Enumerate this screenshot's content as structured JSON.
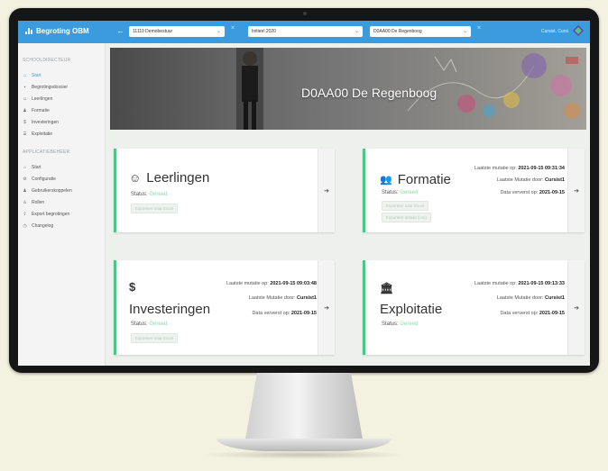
{
  "app": {
    "brand": "Begroting OBM",
    "back_label": "←",
    "selectors": [
      {
        "value": "11110 Demobestuur",
        "clear": "×"
      },
      {
        "value": "Initieel 2020",
        "clear": ""
      },
      {
        "value": "D0AA00 De Regenboog",
        "clear": "×"
      }
    ],
    "user": "Cursist, Cursi"
  },
  "sidebar": {
    "sections": [
      {
        "heading": "SCHOOLDIRECTEUR",
        "items": [
          {
            "label": "Start",
            "icon": "home-icon",
            "active": true
          },
          {
            "label": "Begrotingsdossier",
            "icon": "document-icon",
            "active": false
          },
          {
            "label": "Leerlingen",
            "icon": "smiley-icon",
            "active": false
          },
          {
            "label": "Formatie",
            "icon": "group-icon",
            "active": false
          },
          {
            "label": "Investeringen",
            "icon": "dollar-icon",
            "active": false
          },
          {
            "label": "Exploitatie",
            "icon": "bank-icon",
            "active": false
          }
        ]
      },
      {
        "heading": "APPLICATIEBEHEER",
        "items": [
          {
            "label": "Start",
            "icon": "home-icon",
            "active": false
          },
          {
            "label": "Configuratie",
            "icon": "gear-icon",
            "active": false
          },
          {
            "label": "Gebruikerskoppelen",
            "icon": "users-icon",
            "active": false
          },
          {
            "label": "Rollen",
            "icon": "roles-icon",
            "active": false
          },
          {
            "label": "Export begrotingen",
            "icon": "export-icon",
            "active": false
          },
          {
            "label": "Changelog",
            "icon": "clock-icon",
            "active": false
          }
        ]
      }
    ]
  },
  "banner": {
    "title": "D0AA00 De Regenboog"
  },
  "cards": {
    "leerlingen": {
      "icon_glyph": "☺",
      "title": "Leerlingen",
      "status_label": "Status:",
      "status_value": "Gereed",
      "buttons": [
        "Exporteer naar Excel"
      ],
      "arrow": "➔"
    },
    "formatie": {
      "icon_glyph": "👥",
      "title": "Formatie",
      "status_label": "Status:",
      "status_value": "Gereed",
      "buttons": [
        "Exporteer naar Excel",
        "Exporteer details (csv)"
      ],
      "mutatie_label": "Laatste mutatie op:",
      "mutatie_date": "2021-09-15 09:31:34",
      "door_label": "Laatste Mutatie door:",
      "door_value": "Cursist1",
      "ververst_label": "Data ververst op:",
      "ververst_date": "2021-09-15",
      "arrow": "➔"
    },
    "investeringen": {
      "icon_glyph": "$",
      "title": "Investeringen",
      "status_label": "Status:",
      "status_value": "Gereed",
      "buttons": [
        "Exporteer naar Excel"
      ],
      "mutatie_label": "Laatste mutatie op:",
      "mutatie_date": "2021-09-15 09:03:48",
      "door_label": "Laatste Mutatie door:",
      "door_value": "Cursist1",
      "ververst_label": "Data ververst op:",
      "ververst_date": "2021-09-15",
      "arrow": "➔"
    },
    "exploitatie": {
      "icon_glyph": "🏛",
      "title": "Exploitatie",
      "status_label": "Status:",
      "status_value": "Gereed",
      "mutatie_label": "Laatste mutatie op:",
      "mutatie_date": "2021-09-15 09:13:33",
      "door_label": "Laatste Mutatie door:",
      "door_value": "Cursist1",
      "ververst_label": "Data ververst op:",
      "ververst_date": "2021-09-15",
      "arrow": "➔"
    }
  },
  "colors": {
    "topbar": "#3b9bdc",
    "card_accent": "#4cc788",
    "status_ok": "#8fd6ae"
  }
}
